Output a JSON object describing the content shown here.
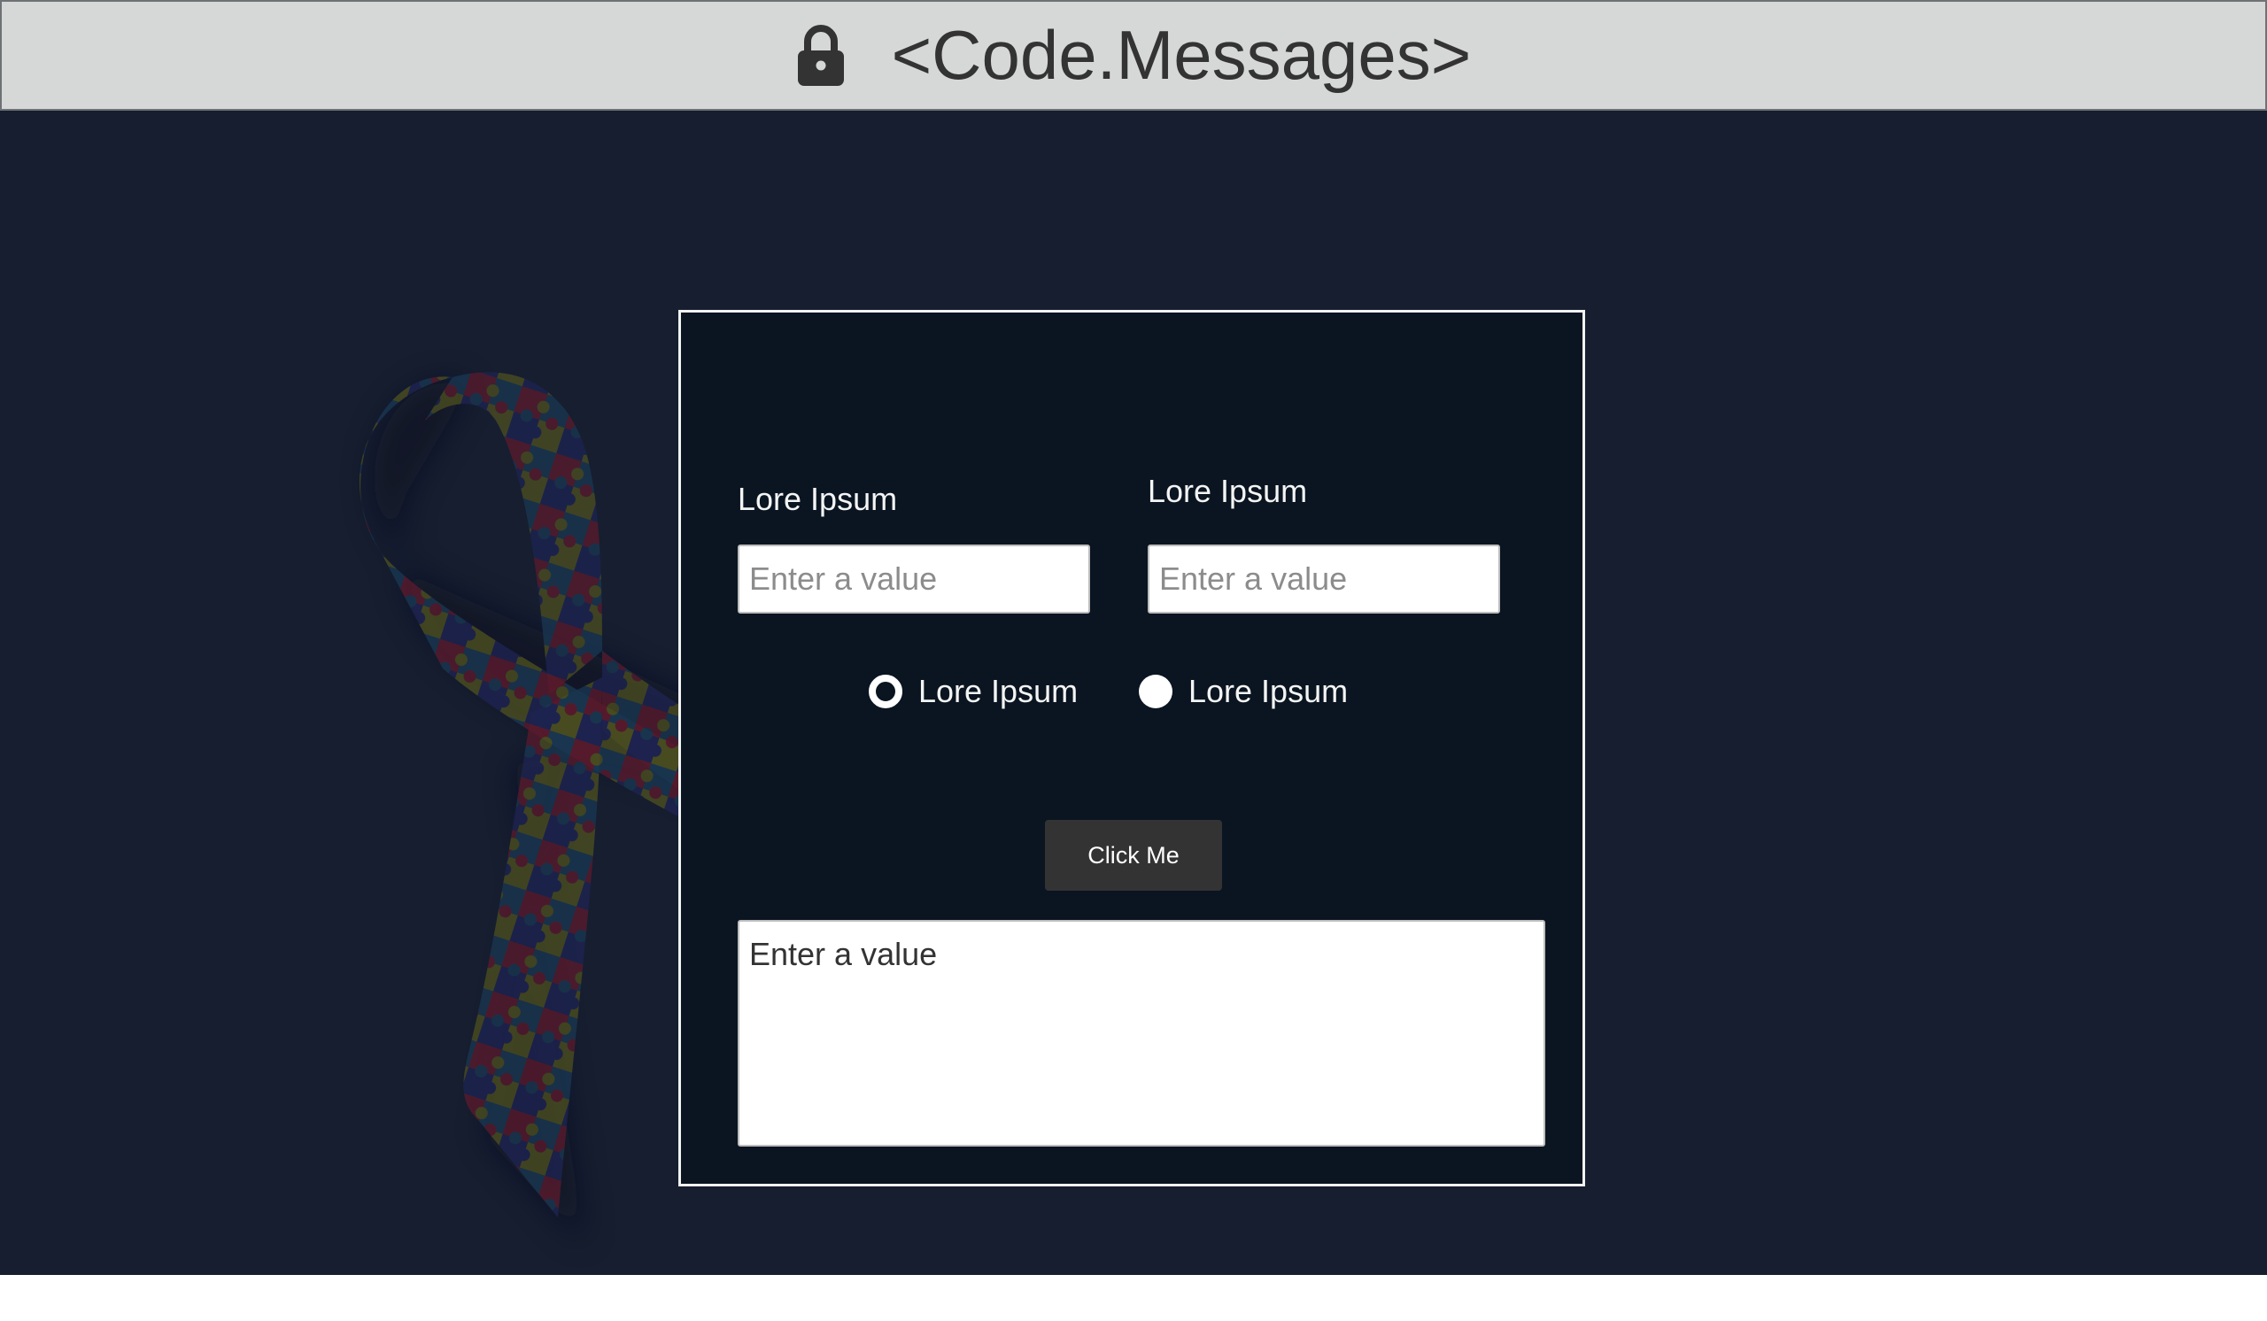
{
  "header": {
    "title": "<Code.Messages>",
    "icon": "lock-icon"
  },
  "form": {
    "field1": {
      "label": "Lore Ipsum",
      "placeholder": "Enter a value",
      "value": ""
    },
    "field2": {
      "label": "Lore Ipsum",
      "placeholder": "Enter a value",
      "value": ""
    },
    "radios": [
      {
        "label": "Lore Ipsum",
        "checked": true
      },
      {
        "label": "Lore Ipsum",
        "checked": false
      }
    ],
    "button_label": "Click Me",
    "message": {
      "placeholder": "Enter a value",
      "value": ""
    }
  },
  "background": {
    "image": "autism-awareness-puzzle-ribbon"
  },
  "colors": {
    "header_bg": "#d6d8d8",
    "page_bg": "#161e30",
    "card_bg": "#0a1521",
    "button_bg": "#333333",
    "ribbon_red": "#571a2c",
    "ribbon_navy": "#1d2350",
    "ribbon_olive": "#4a4d1f",
    "ribbon_teal": "#193650"
  }
}
